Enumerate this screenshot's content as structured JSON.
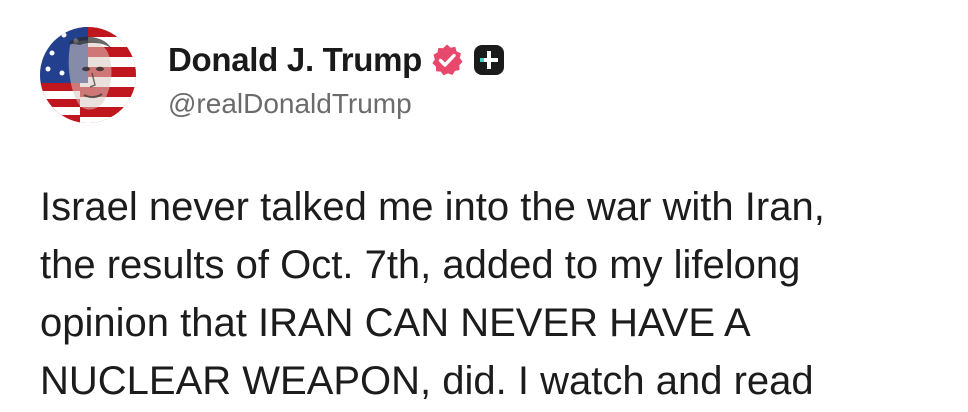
{
  "author": {
    "display_name": "Donald J. Trump",
    "handle": "@realDonaldTrump",
    "avatar_icon": "flag-portrait-avatar",
    "verified_icon": "verified-badge-icon",
    "plus_icon": "plus-badge-icon",
    "verified_color": "#e8486b"
  },
  "post": {
    "lines": [
      "Israel never talked me into the war with Iran,",
      "the results of Oct. 7th, added to my lifelong",
      "opinion that IRAN CAN NEVER HAVE A",
      "NUCLEAR WEAPON, did. I watch and read"
    ]
  }
}
